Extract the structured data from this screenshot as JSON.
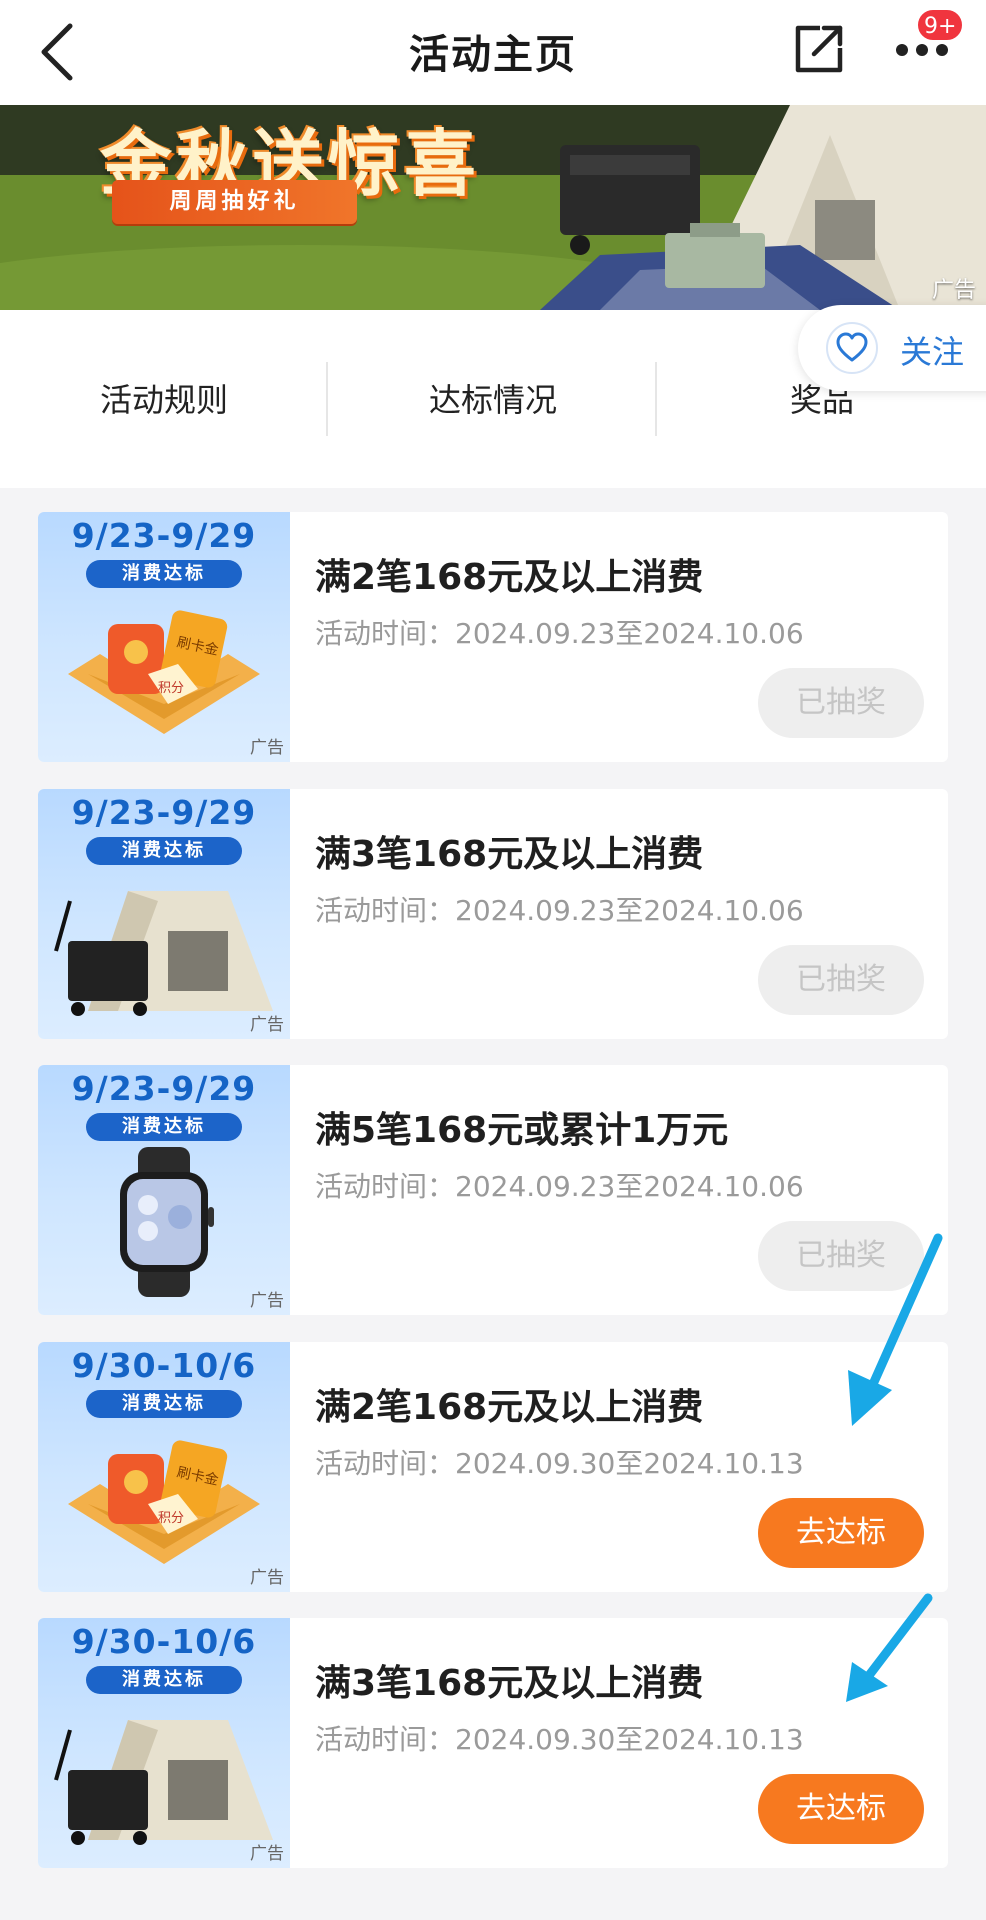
{
  "header": {
    "title": "活动主页",
    "notification_badge": "9+"
  },
  "banner": {
    "title": "金秋送惊喜",
    "subtitle": "周周抽好礼",
    "ad_label": "广告"
  },
  "follow": {
    "label": "关注"
  },
  "tabs": [
    {
      "label": "活动规则"
    },
    {
      "label": "达标情况"
    },
    {
      "label": "奖品"
    }
  ],
  "cards": [
    {
      "thumb_date": "9/23-9/29",
      "thumb_tag": "消费达标",
      "thumb_art": "red-packet-icon",
      "ad_label": "广告",
      "title": "满2笔168元及以上消费",
      "time": "活动时间：2024.09.23至2024.10.06",
      "button": "已抽奖",
      "button_state": "done"
    },
    {
      "thumb_date": "9/23-9/29",
      "thumb_tag": "消费达标",
      "thumb_art": "tent-icon",
      "ad_label": "广告",
      "title": "满3笔168元及以上消费",
      "time": "活动时间：2024.09.23至2024.10.06",
      "button": "已抽奖",
      "button_state": "done"
    },
    {
      "thumb_date": "9/23-9/29",
      "thumb_tag": "消费达标",
      "thumb_art": "smartwatch-icon",
      "ad_label": "广告",
      "title": "满5笔168元或累计1万元",
      "time": "活动时间：2024.09.23至2024.10.06",
      "button": "已抽奖",
      "button_state": "done"
    },
    {
      "thumb_date": "9/30-10/6",
      "thumb_tag": "消费达标",
      "thumb_art": "red-packet-icon",
      "ad_label": "广告",
      "title": "满2笔168元及以上消费",
      "time": "活动时间：2024.09.30至2024.10.13",
      "button": "去达标",
      "button_state": "active"
    },
    {
      "thumb_date": "9/30-10/6",
      "thumb_tag": "消费达标",
      "thumb_art": "tent-icon",
      "ad_label": "广告",
      "title": "满3笔168元及以上消费",
      "time": "活动时间：2024.09.30至2024.10.13",
      "button": "去达标",
      "button_state": "active"
    }
  ],
  "colors": {
    "accent_orange": "#f7791f",
    "link_blue": "#2a79d6",
    "annotation_arrow": "#19a8e6",
    "badge_red": "#f0353e"
  }
}
